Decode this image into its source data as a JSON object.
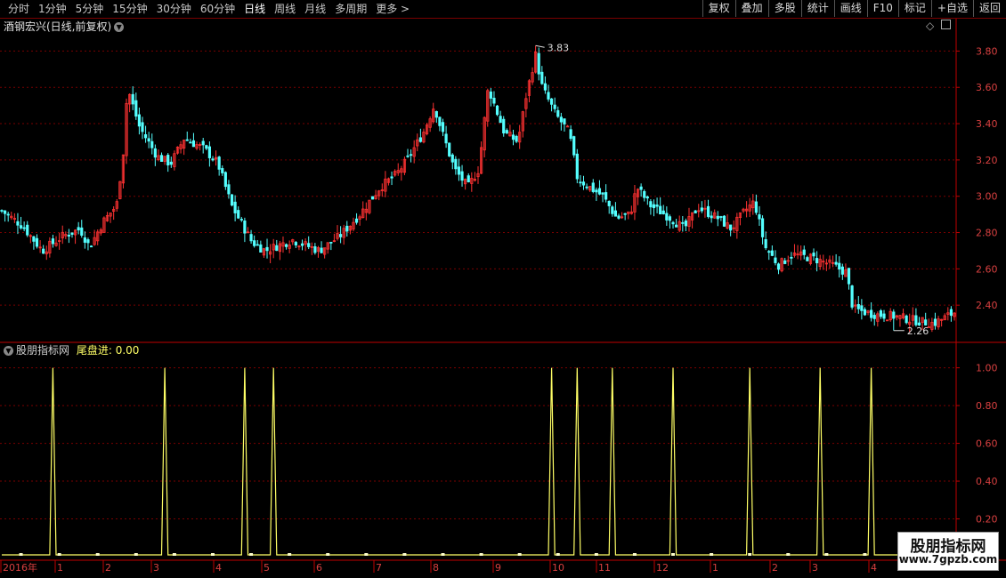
{
  "toolbar": {
    "periods": [
      "分时",
      "1分钟",
      "5分钟",
      "15分钟",
      "30分钟",
      "60分钟",
      "日线",
      "周线",
      "月线",
      "多周期",
      "更多 >"
    ],
    "active_period": "日线",
    "actions": [
      "复权",
      "叠加",
      "多股",
      "统计",
      "画线",
      "F10",
      "标记",
      "+自选",
      "返回"
    ]
  },
  "main_panel": {
    "title": "酒钢宏兴(日线,前复权)",
    "high_label": "3.83",
    "low_label": "2.26"
  },
  "indicator_panel": {
    "name": "股朋指标网",
    "indicator_label": "尾盘进: ",
    "indicator_value": "0.00"
  },
  "x_axis": {
    "labels": [
      "2016年",
      "1",
      "2",
      "3",
      "4",
      "5",
      "6",
      "7",
      "8",
      "9",
      "10",
      "11",
      "12",
      "1",
      "2",
      "3",
      "4"
    ]
  },
  "watermark": {
    "title": "股朋指标网",
    "url": "www.7gpzb.com"
  },
  "colors": {
    "up": "#ff3232",
    "down": "#54ffff",
    "signal": "#ffff66",
    "grid": "#7a0000",
    "axis": "#c00000"
  },
  "chart_data": [
    {
      "type": "candlestick",
      "title": "酒钢宏兴(日线,前复权)",
      "ylim": [
        2.2,
        3.9
      ],
      "yticks": [
        2.4,
        2.6,
        2.8,
        3.0,
        3.2,
        3.4,
        3.6,
        3.8
      ],
      "max": 3.83,
      "min": 2.26,
      "close_path": [
        [
          0,
          2.92
        ],
        [
          15,
          2.84
        ],
        [
          30,
          2.7
        ],
        [
          45,
          2.78
        ],
        [
          58,
          2.82
        ],
        [
          65,
          2.72
        ],
        [
          75,
          2.86
        ],
        [
          85,
          2.95
        ],
        [
          90,
          3.25
        ],
        [
          93,
          3.6
        ],
        [
          97,
          3.5
        ],
        [
          102,
          3.38
        ],
        [
          115,
          3.22
        ],
        [
          125,
          3.18
        ],
        [
          135,
          3.32
        ],
        [
          150,
          3.26
        ],
        [
          160,
          3.18
        ],
        [
          170,
          2.95
        ],
        [
          185,
          2.75
        ],
        [
          195,
          2.7
        ],
        [
          215,
          2.76
        ],
        [
          235,
          2.7
        ],
        [
          250,
          2.78
        ],
        [
          265,
          2.9
        ],
        [
          280,
          3.05
        ],
        [
          292,
          3.12
        ],
        [
          300,
          3.2
        ],
        [
          312,
          3.35
        ],
        [
          320,
          3.5
        ],
        [
          326,
          3.35
        ],
        [
          335,
          3.15
        ],
        [
          345,
          3.05
        ],
        [
          353,
          3.15
        ],
        [
          360,
          3.6
        ],
        [
          372,
          3.35
        ],
        [
          382,
          3.3
        ],
        [
          388,
          3.55
        ],
        [
          395,
          3.78
        ],
        [
          400,
          3.6
        ],
        [
          410,
          3.45
        ],
        [
          420,
          3.35
        ],
        [
          426,
          3.1
        ],
        [
          435,
          3.05
        ],
        [
          445,
          3.0
        ],
        [
          455,
          2.88
        ],
        [
          465,
          2.9
        ],
        [
          470,
          3.05
        ],
        [
          480,
          2.95
        ],
        [
          495,
          2.88
        ],
        [
          505,
          2.82
        ],
        [
          515,
          2.94
        ],
        [
          530,
          2.88
        ],
        [
          540,
          2.82
        ],
        [
          550,
          2.92
        ],
        [
          557,
          2.97
        ],
        [
          565,
          2.72
        ],
        [
          575,
          2.62
        ],
        [
          585,
          2.68
        ],
        [
          600,
          2.66
        ],
        [
          615,
          2.62
        ],
        [
          625,
          2.58
        ],
        [
          630,
          2.38
        ],
        [
          645,
          2.35
        ],
        [
          660,
          2.34
        ],
        [
          680,
          2.31
        ],
        [
          690,
          2.3
        ],
        [
          705,
          2.36
        ]
      ],
      "n_bars": 299
    },
    {
      "type": "line",
      "series": [
        {
          "name": "尾盘进",
          "values_by_bar": "0 except spikes to 1.00"
        }
      ],
      "ylim": [
        0,
        1.05
      ],
      "yticks": [
        0.2,
        0.4,
        0.6,
        0.8,
        1.0
      ],
      "signal_bars": [
        16,
        51,
        76,
        85,
        172,
        180,
        191,
        210,
        234,
        256,
        272
      ]
    }
  ]
}
